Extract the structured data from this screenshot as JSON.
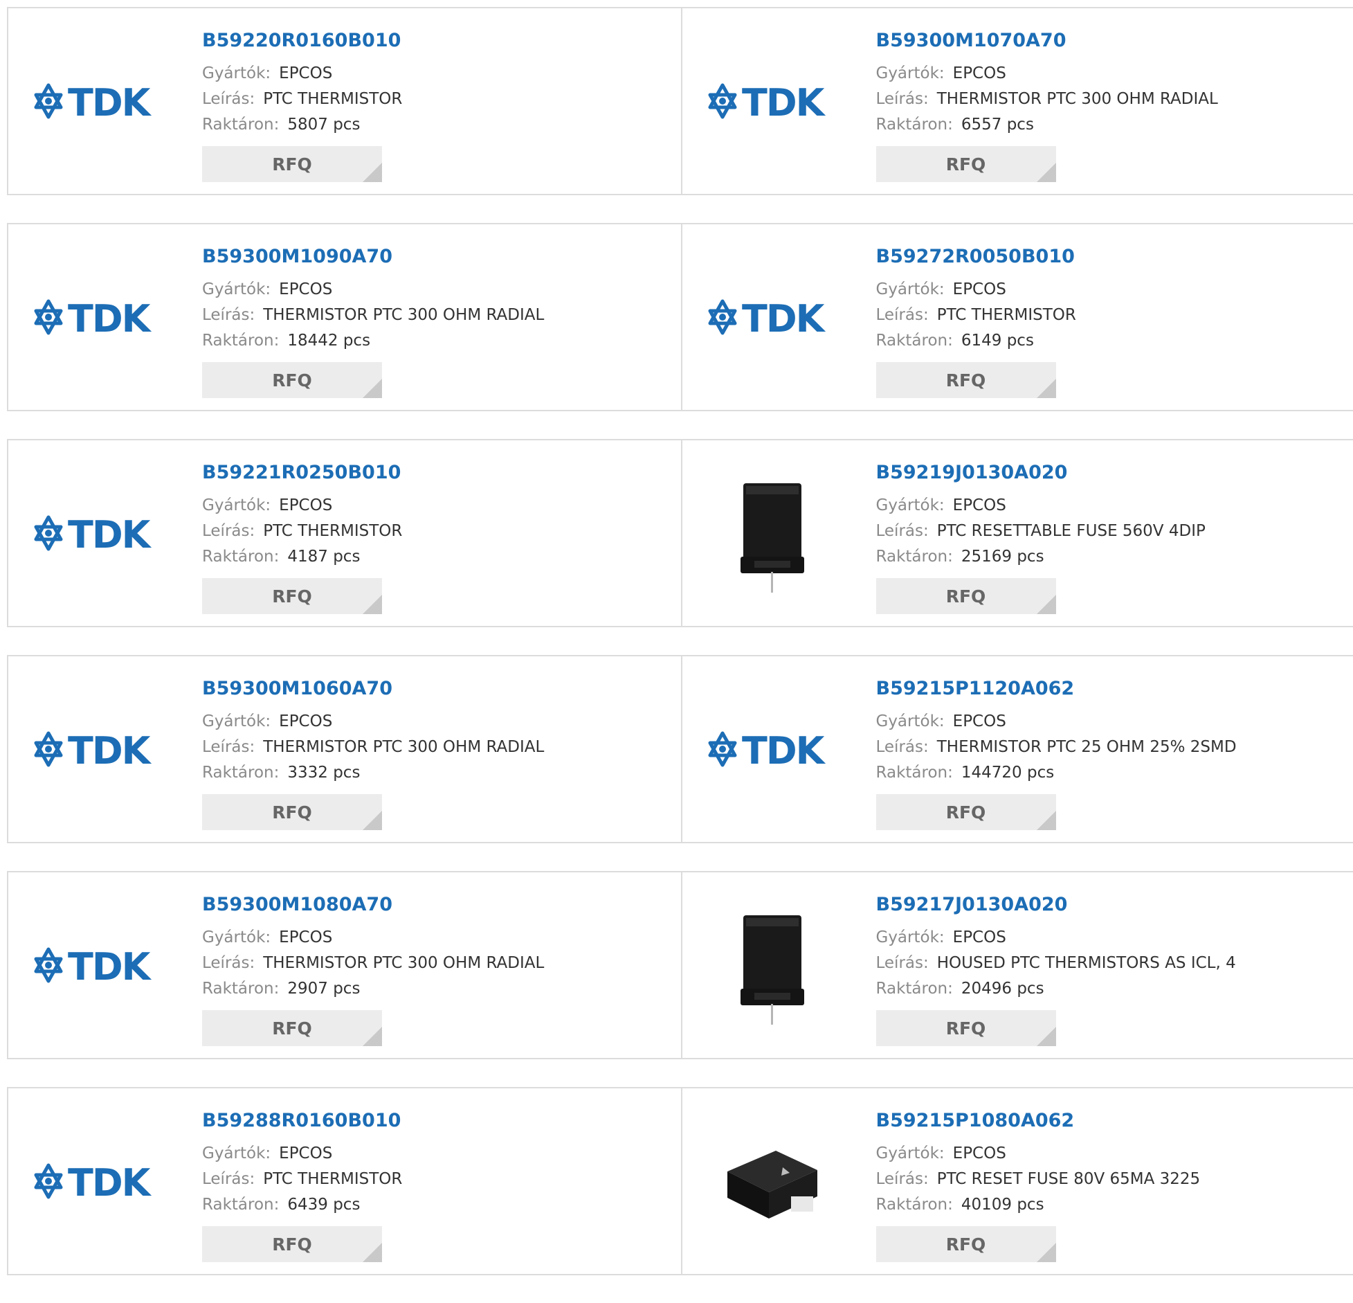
{
  "colors": {
    "part_link": "#1c6db5",
    "label": "#8a8a8a",
    "value": "#333333",
    "border": "#dcdcdc",
    "rfq_bg": "#ececec",
    "tdk_logo": "#1c6db5"
  },
  "labels": {
    "manufacturer": "Gyártók:",
    "description": "Leírás:",
    "stock": "Raktáron:",
    "rfq": "RFQ",
    "logo_text": "TDK"
  },
  "products": [
    {
      "part": "B59220R0160B010",
      "manufacturer": "EPCOS",
      "description": "PTC THERMISTOR",
      "stock": "5807 pcs",
      "image": "tdk-logo"
    },
    {
      "part": "B59300M1070A70",
      "manufacturer": "EPCOS",
      "description": "THERMISTOR PTC 300 OHM RADIAL",
      "stock": "6557 pcs",
      "image": "tdk-logo"
    },
    {
      "part": "B59300M1090A70",
      "manufacturer": "EPCOS",
      "description": "THERMISTOR PTC 300 OHM RADIAL",
      "stock": "18442 pcs",
      "image": "tdk-logo"
    },
    {
      "part": "B59272R0050B010",
      "manufacturer": "EPCOS",
      "description": "PTC THERMISTOR",
      "stock": "6149 pcs",
      "image": "tdk-logo"
    },
    {
      "part": "B59221R0250B010",
      "manufacturer": "EPCOS",
      "description": "PTC THERMISTOR",
      "stock": "4187 pcs",
      "image": "tdk-logo"
    },
    {
      "part": "B59219J0130A020",
      "manufacturer": "EPCOS",
      "description": "PTC RESETTABLE FUSE 560V 4DIP",
      "stock": "25169 pcs",
      "image": "housed-thermistor-photo"
    },
    {
      "part": "B59300M1060A70",
      "manufacturer": "EPCOS",
      "description": "THERMISTOR PTC 300 OHM RADIAL",
      "stock": "3332 pcs",
      "image": "tdk-logo"
    },
    {
      "part": "B59215P1120A062",
      "manufacturer": "EPCOS",
      "description": "THERMISTOR PTC 25 OHM 25% 2SMD",
      "stock": "144720 pcs",
      "image": "tdk-logo"
    },
    {
      "part": "B59300M1080A70",
      "manufacturer": "EPCOS",
      "description": "THERMISTOR PTC 300 OHM RADIAL",
      "stock": "2907 pcs",
      "image": "tdk-logo"
    },
    {
      "part": "B59217J0130A020",
      "manufacturer": "EPCOS",
      "description": "HOUSED PTC THERMISTORS AS ICL, 4",
      "stock": "20496 pcs",
      "image": "housed-thermistor-photo"
    },
    {
      "part": "B59288R0160B010",
      "manufacturer": "EPCOS",
      "description": "PTC THERMISTOR",
      "stock": "6439 pcs",
      "image": "tdk-logo"
    },
    {
      "part": "B59215P1080A062",
      "manufacturer": "EPCOS",
      "description": "PTC RESET FUSE 80V 65MA 3225",
      "stock": "40109 pcs",
      "image": "smd-fuse-photo"
    }
  ]
}
